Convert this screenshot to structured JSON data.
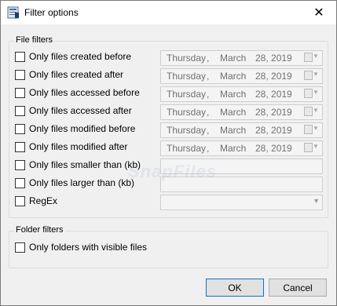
{
  "window": {
    "title": "Filter options"
  },
  "file_filters": {
    "group_label": "File filters",
    "rows": [
      {
        "label": "Only files created before",
        "control": "date",
        "day": "Thursday",
        "sep": ",",
        "month": "March",
        "date": "28, 2019"
      },
      {
        "label": "Only files created after",
        "control": "date",
        "day": "Thursday",
        "sep": ",",
        "month": "March",
        "date": "28, 2019"
      },
      {
        "label": "Only files accessed before",
        "control": "date",
        "day": "Thursday",
        "sep": ",",
        "month": "March",
        "date": "28, 2019"
      },
      {
        "label": "Only files accessed after",
        "control": "date",
        "day": "Thursday",
        "sep": ",",
        "month": "March",
        "date": "28, 2019"
      },
      {
        "label": "Only files modified before",
        "control": "date",
        "day": "Thursday",
        "sep": ",",
        "month": "March",
        "date": "28, 2019"
      },
      {
        "label": "Only files modified after",
        "control": "date",
        "day": "Thursday",
        "sep": ",",
        "month": "March",
        "date": "28, 2019"
      },
      {
        "label": "Only files smaller than (kb)",
        "control": "text",
        "value": ""
      },
      {
        "label": "Only files larger than (kb)",
        "control": "text",
        "value": ""
      },
      {
        "label": "RegEx",
        "control": "combo",
        "value": ""
      }
    ]
  },
  "folder_filters": {
    "group_label": "Folder filters",
    "rows": [
      {
        "label": "Only folders with visible files"
      }
    ]
  },
  "buttons": {
    "ok": "OK",
    "cancel": "Cancel"
  },
  "icons": {
    "app": "filter-options-app-icon",
    "close": "close-icon",
    "calendar": "calendar-icon",
    "dropdown": "chevron-down-icon"
  },
  "watermark": "SnapFiles",
  "colors": {
    "title_bg": "#ffffff",
    "dialog_bg": "#f0f0f0",
    "ok_border": "#0078d7"
  }
}
